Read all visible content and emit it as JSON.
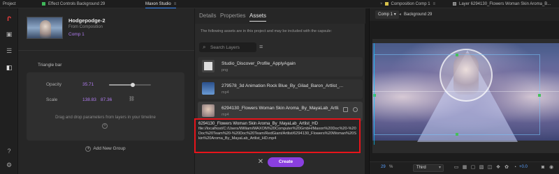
{
  "top_tabs": [
    {
      "label": "Project"
    },
    {
      "label": "Effect Controls Background 29"
    },
    {
      "label": "Maxon Studio"
    },
    {
      "label": "Composition Comp 1"
    },
    {
      "label": "Layer 6294130_Flowers Woman Skin Aroma_B..."
    }
  ],
  "composition": {
    "name": "Hodgepodge-2",
    "source_label": "From Composition",
    "source_name": "Comp 1"
  },
  "group": {
    "title": "Triangle bar",
    "params": [
      {
        "label": "Opacity",
        "value": "35.71",
        "fraction": 0.57
      },
      {
        "label": "Scale",
        "value_x": "138.83",
        "value_y": "87.36"
      }
    ],
    "drop_hint": "Drag and drop parameters from layers in your timeline",
    "add_group_label": "Add New Group"
  },
  "center": {
    "tabs": [
      "Details",
      "Properties",
      "Assets"
    ],
    "active_tab": "Assets",
    "info": "The following assets are in this project and may be included with the capsule:",
    "search_placeholder": "Search Layers",
    "assets": [
      {
        "name": "Studio_Discover_Profile_ApplyAgain",
        "ext": "png"
      },
      {
        "name": "279578_3d Animation Rock Blue_By_Gilad_Baron_Artlist_...",
        "ext": "mp4"
      },
      {
        "name": "6294130_Flowers Woman Skin Aroma_By_MayaLab_Artli...",
        "ext": "mp4"
      }
    ],
    "tooltip_title": "6294130_Flowers Woman Skin Aroma_By_MayaLab_Artlist_HD",
    "tooltip_path": "file://localhost/C:/Users/William/MAXON%20Computer%20GmbH/Maxon%20Doc%20-%20Doc%20Team%20-%20Doc%20Team/RedGiant/Artlist/6294130_Flowers%20Woman%20Skin%20Aroma_By_MayaLab_Artlist_HD.mp4",
    "create_label": "Create"
  },
  "viewer": {
    "comp_button": "Comp 1",
    "breadcrumb": "Background 29",
    "zoom": "29",
    "zoom_unit": "%",
    "resolution": "Third",
    "exposure": "+0.0"
  },
  "colors": {
    "accent_purple": "#8a3fe0",
    "highlight_red": "#e8141b",
    "blue": "#3b8cff"
  }
}
